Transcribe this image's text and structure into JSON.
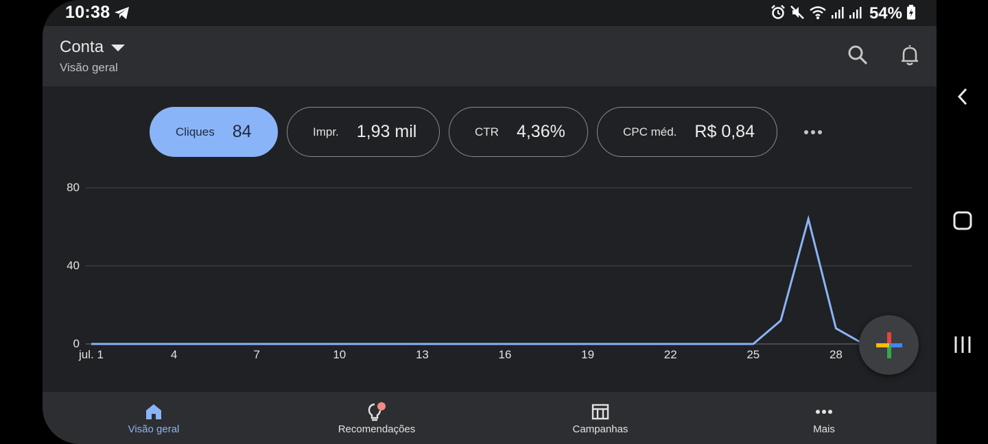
{
  "status_bar": {
    "time": "10:38",
    "battery": "54%"
  },
  "app_bar": {
    "title": "Conta",
    "subtitle": "Visão geral"
  },
  "metrics": [
    {
      "label": "Cliques",
      "value": "84",
      "active": true
    },
    {
      "label": "Impr.",
      "value": "1,93 mil",
      "active": false
    },
    {
      "label": "CTR",
      "value": "4,36%",
      "active": false
    },
    {
      "label": "CPC méd.",
      "value": "R$ 0,84",
      "active": false
    }
  ],
  "chart_data": {
    "type": "line",
    "x": [
      1,
      2,
      3,
      4,
      5,
      6,
      7,
      8,
      9,
      10,
      11,
      12,
      13,
      14,
      15,
      16,
      17,
      18,
      19,
      20,
      21,
      22,
      23,
      24,
      25,
      26,
      27,
      28,
      29
    ],
    "series": [
      {
        "values": [
          0,
          0,
          0,
          0,
          0,
          0,
          0,
          0,
          0,
          0,
          0,
          0,
          0,
          0,
          0,
          0,
          0,
          0,
          0,
          0,
          0,
          0,
          0,
          0,
          0,
          12,
          64,
          8,
          0
        ]
      }
    ],
    "x_tick_labels": [
      "jul. 1",
      "4",
      "7",
      "10",
      "13",
      "16",
      "19",
      "22",
      "25",
      "28"
    ],
    "y_tick_labels": [
      "0",
      "40",
      "80"
    ],
    "ylim": [
      0,
      80
    ],
    "grid": true,
    "color": "#8ab4f8"
  },
  "bottom_nav": [
    {
      "label": "Visão geral",
      "icon": "home-icon",
      "active": true
    },
    {
      "label": "Recomendações",
      "icon": "lightbulb-icon",
      "active": false
    },
    {
      "label": "Campanhas",
      "icon": "table-icon",
      "active": false
    },
    {
      "label": "Mais",
      "icon": "more-horiz-icon",
      "active": false
    }
  ],
  "colors": {
    "accent": "#8ab4f8",
    "background": "#202124",
    "surface": "#2d2e31",
    "badge": "#f28b82"
  }
}
